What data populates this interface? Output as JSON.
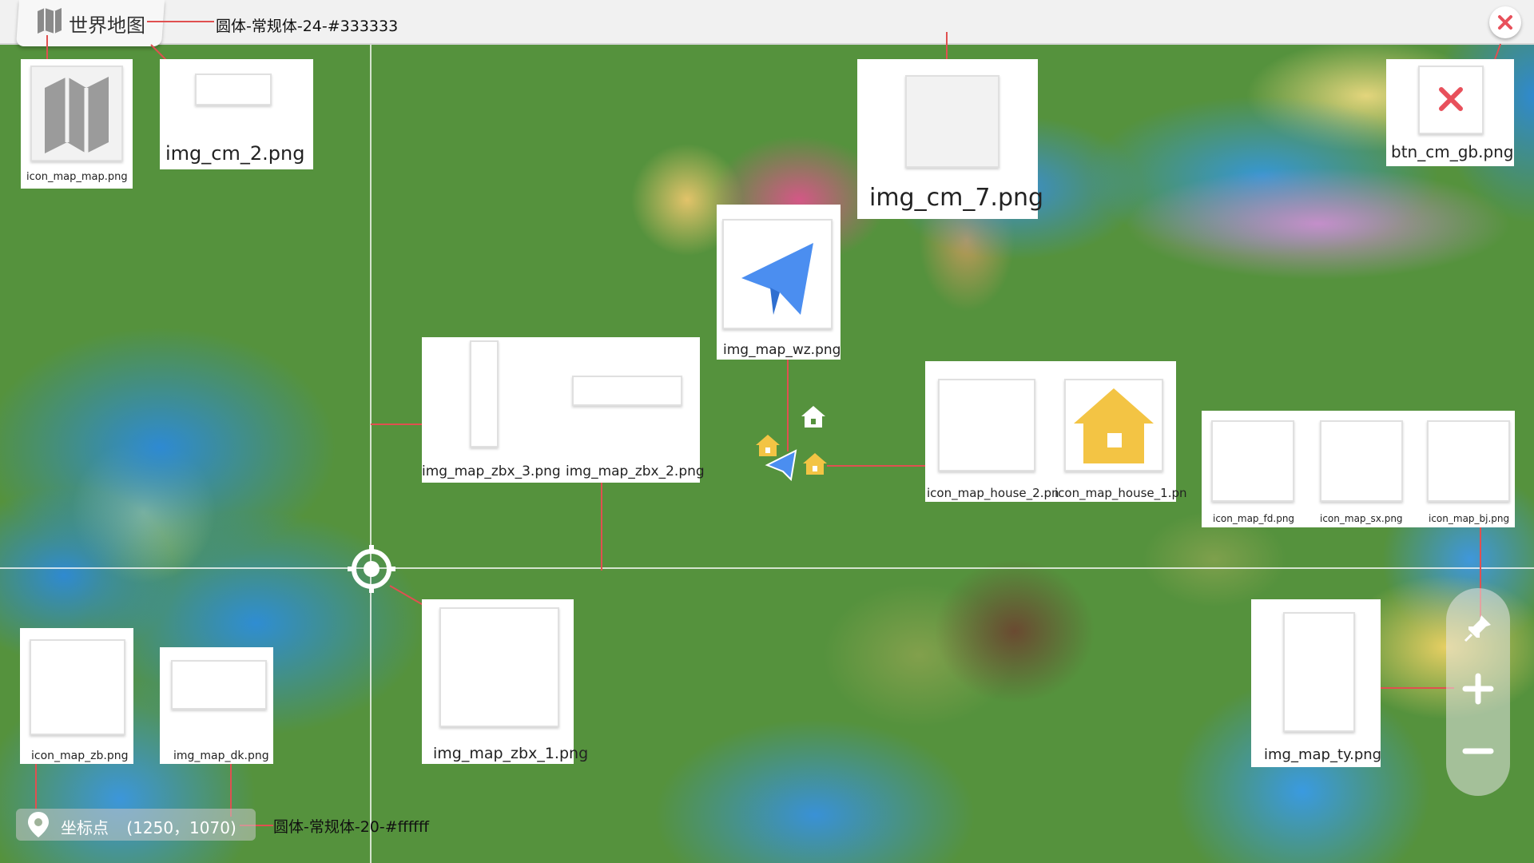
{
  "colors": {
    "title_color": "#333333",
    "coord_color": "#ffffff",
    "annotation_line": "#e05050",
    "brand_blue": "#4b8ef0",
    "house_yellow": "#f3c444"
  },
  "header": {
    "title": "世界地图",
    "title_style_note": "圆体-常规体-24-#333333"
  },
  "coord": {
    "label": "坐标点",
    "value": "(1250，1070)",
    "style_note": "圆体-常规体-20-#ffffff"
  },
  "assets": {
    "icon_map_map": "icon_map_map.png",
    "img_cm_2": "img_cm_2.png",
    "img_cm_7": "img_cm_7.png",
    "btn_cm_gb": "btn_cm_gb.png",
    "img_map_wz": "img_map_wz.png",
    "img_map_zbx_3": "img_map_zbx_3.png",
    "img_map_zbx_2": "img_map_zbx_2.png",
    "icon_map_house_2": "icon_map_house_2.pn",
    "icon_map_house_1": "icon_map_house_1.pn",
    "icon_map_fd": "icon_map_fd.png",
    "icon_map_sx": "icon_map_sx.png",
    "icon_map_bj": "icon_map_bj.png",
    "img_map_zbx_1": "img_map_zbx_1.png",
    "img_map_ty": "img_map_ty.png",
    "icon_map_zb": "icon_map_zb.png",
    "img_map_dk": "img_map_dk.png"
  },
  "icons": {
    "map": "map-icon",
    "close": "close-icon",
    "send": "paper-plane-icon",
    "house": "house-icon",
    "crosshair": "crosshair-icon",
    "pin": "pin-icon",
    "zoom_in": "plus-icon",
    "zoom_out": "minus-icon",
    "location": "location-pin-icon"
  }
}
